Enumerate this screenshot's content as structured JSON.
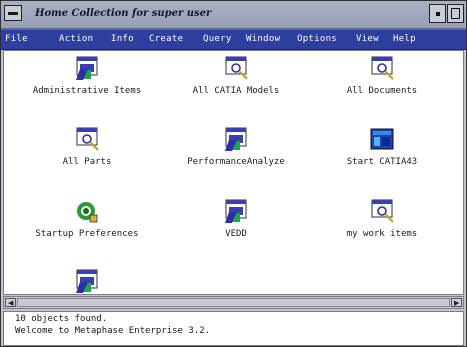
{
  "window": {
    "title": "Home Collection for super user"
  },
  "menubar": {
    "items": [
      "File",
      "Action",
      "Info",
      "Create",
      "Query",
      "Window",
      "Options",
      "View",
      "Help"
    ]
  },
  "objects": [
    {
      "label": "Administrative Items",
      "icon": "folder-window-icon"
    },
    {
      "label": "All CATIA Models",
      "icon": "magnifier-query-icon"
    },
    {
      "label": "All Documents",
      "icon": "magnifier-query-icon"
    },
    {
      "label": "All Parts",
      "icon": "magnifier-query-icon"
    },
    {
      "label": "PerformanceAnalyze",
      "icon": "folder-window-icon"
    },
    {
      "label": "Start CATIA43",
      "icon": "catia-app-icon"
    },
    {
      "label": "Startup Preferences",
      "icon": "preferences-gear-icon"
    },
    {
      "label": "VEDD",
      "icon": "folder-window-icon"
    },
    {
      "label": "my work items",
      "icon": "magnifier-query-icon"
    },
    {
      "label": "",
      "icon": "folder-window-icon"
    }
  ],
  "messages": {
    "line1": "10 objects found.",
    "line2": "Welcome to Metaphase Enterprise 3.2."
  },
  "colors": {
    "menubar_bg": "#2e3fa0",
    "titlebar_bg": "#a4aabc",
    "content_bg": "#ffffff"
  }
}
